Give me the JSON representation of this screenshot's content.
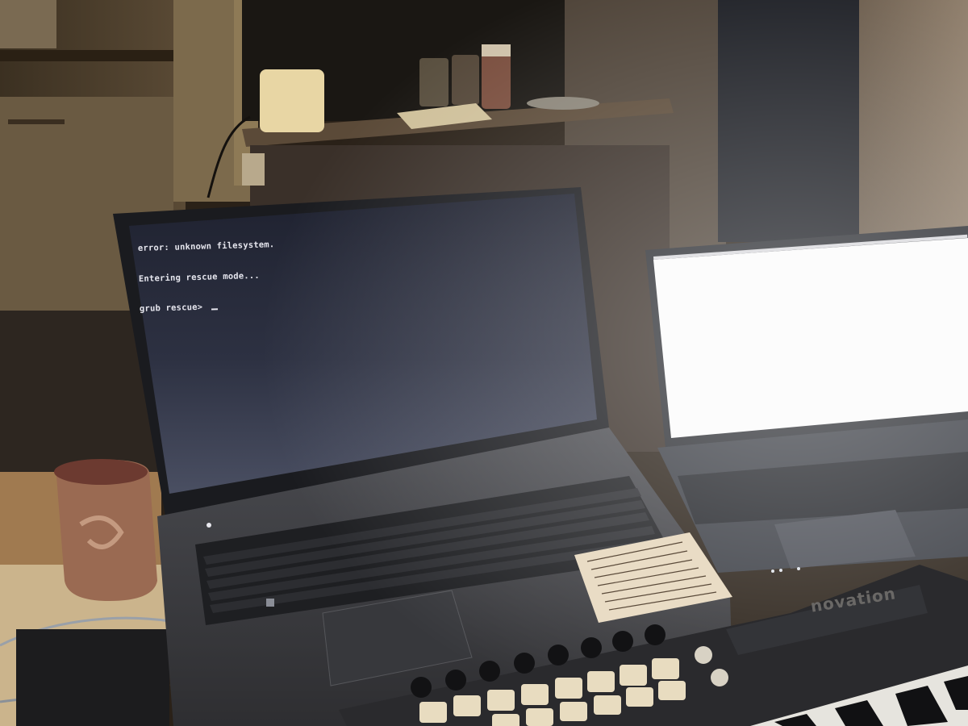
{
  "scene": {
    "left_laptop_screen": {
      "lines": [
        "error: unknown filesystem.",
        "Entering rescue mode...",
        "grub rescue> "
      ]
    },
    "keyboard_brand": "novation",
    "colors": {
      "room": "#2a2118",
      "screen_dark": "#3a3d4e",
      "screen_bright": "#fbfbfb",
      "laptop_body": "#3f3f42",
      "key_pad": "#e8dcc0"
    },
    "icons": [
      "power-led-icon",
      "windows-key-icon"
    ]
  }
}
